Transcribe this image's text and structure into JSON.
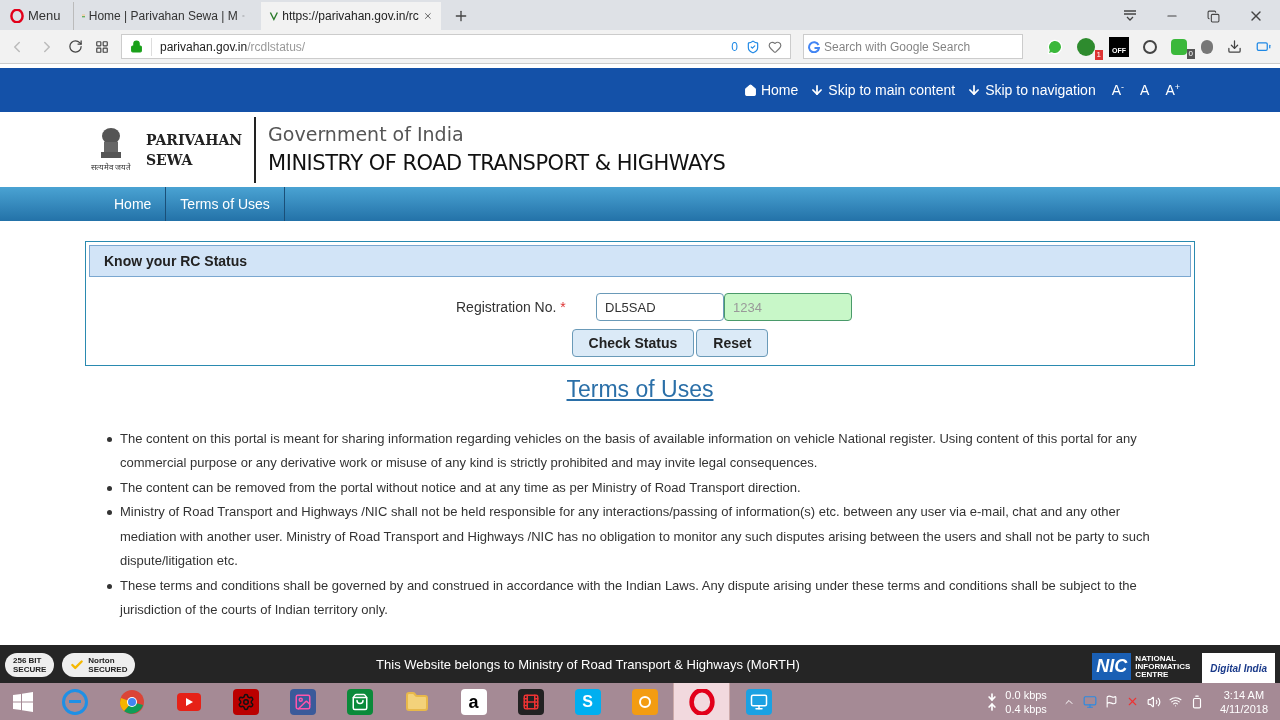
{
  "browser": {
    "menu_label": "Menu",
    "tabs": [
      {
        "title": "Home | Parivahan Sewa | M",
        "selected": false
      },
      {
        "title": "https://parivahan.gov.in/rc",
        "selected": true
      }
    ],
    "address": {
      "host": "parivahan.gov.in",
      "path": "/rcdlstatus/"
    },
    "blocked_count": "0",
    "search_placeholder": "Search with Google Search",
    "extension_badges": [
      "1",
      "OFF",
      "0"
    ]
  },
  "topbar": {
    "links": [
      "Home",
      "Skip to main content",
      "Skip to navigation"
    ],
    "font_sizes": [
      {
        "label": "A",
        "sup": "-"
      },
      {
        "label": "A"
      },
      {
        "label": "A",
        "sup": "+"
      }
    ]
  },
  "header": {
    "logo_text": [
      "PARIVAHAN",
      "SEWA"
    ],
    "emblem_caption": "सत्यमेव जयते",
    "subtitle": "Government of India",
    "title": "MINISTRY OF ROAD TRANSPORT & HIGHWAYS"
  },
  "nav": [
    {
      "label": "Home",
      "selected": false
    },
    {
      "label": "Terms of Uses",
      "selected": false
    }
  ],
  "form": {
    "title": "Know your RC Status",
    "label": "Registration No.",
    "required_mark": "*",
    "fields": [
      {
        "value": "DL5SAD",
        "focused": false
      },
      {
        "placeholder": "1234",
        "focused": true
      }
    ],
    "buttons": [
      "Check Status",
      "Reset"
    ]
  },
  "terms": {
    "heading": "Terms of Uses",
    "items": [
      "The content on this portal is meant for sharing information regarding vehicles on the basis of available information on vehicle National register. Using content of this portal for any commercial purpose or any derivative work or misuse of any kind is strictly prohibited and may invite legal consequences.",
      "The content can be removed from the portal without notice and at any time as per Ministry of Road Transport direction.",
      "Ministry of Road Transport and Highways /NIC shall not be held responsible for any interactions/passing of information(s) etc. between any user via e-mail, chat and any other mediation with another user. Ministry of Road Transport and Highways /NIC has no obligation to monitor any such disputes arising between the users and shall not be party to such dispute/litigation etc.",
      "These terms and conditions shall be governed by and construed in accordance with the Indian Laws. Any dispute arising under these terms and conditions shall be subject to the jurisdiction of the courts of Indian territory only."
    ]
  },
  "footer": {
    "badges": [
      {
        "top": "256 BIT",
        "bottom": "SECURE"
      },
      {
        "top": "Norton",
        "bottom": "SECURED"
      }
    ],
    "text": "This Website belongs to Ministry of Road Transport & Highways (MoRTH)",
    "nic": {
      "short": "NIC",
      "long": [
        "NATIONAL",
        "INFORMATICS",
        "CENTRE"
      ]
    },
    "digital_india": "Digital India"
  },
  "taskbar": {
    "apps": [
      {
        "kind": "ie",
        "selected": false
      },
      {
        "kind": "chrome",
        "selected": false
      },
      {
        "kind": "youtube",
        "selected": false
      },
      {
        "kind": "gear",
        "selected": false
      },
      {
        "kind": "photo",
        "selected": false
      },
      {
        "kind": "store",
        "selected": false
      },
      {
        "kind": "folder",
        "selected": false
      },
      {
        "kind": "amazon",
        "selected": false
      },
      {
        "kind": "film",
        "selected": false
      },
      {
        "kind": "skype",
        "selected": false
      },
      {
        "kind": "uc",
        "selected": false
      },
      {
        "kind": "opera",
        "selected": true
      },
      {
        "kind": "screen",
        "selected": false
      }
    ],
    "amazon_letter": "a",
    "skype_letter": "S",
    "speeds": [
      "0.0 kbps",
      "0.4 kbps"
    ],
    "time": "3:14 AM",
    "date": "4/11/2018"
  }
}
